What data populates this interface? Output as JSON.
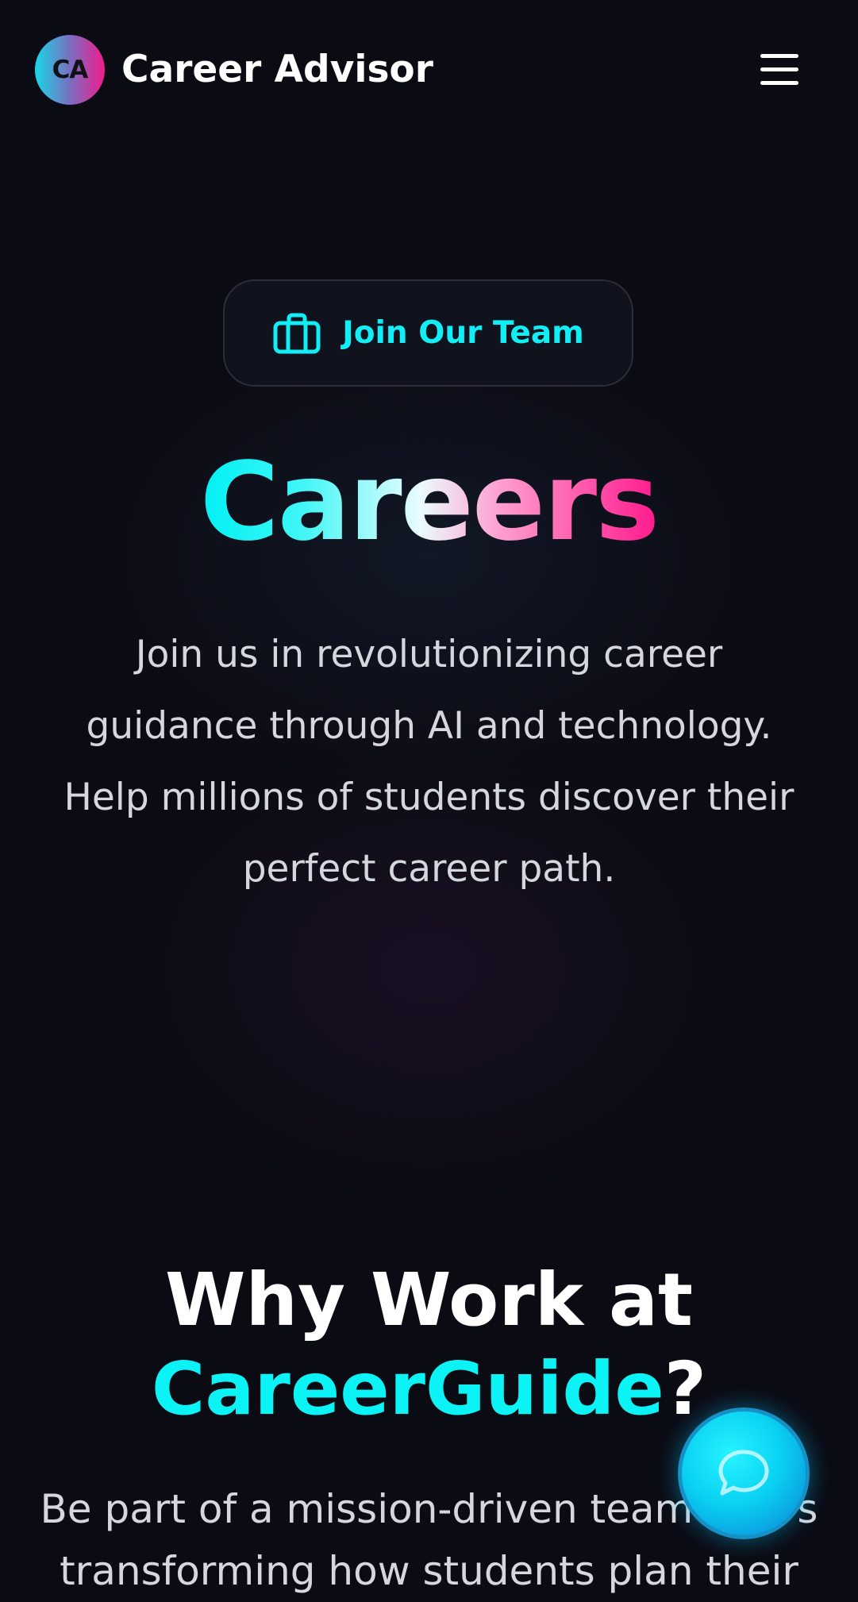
{
  "header": {
    "logo_initials": "CA",
    "brand_name": "Career Advisor",
    "menu_icon": "hamburger-menu-icon"
  },
  "hero": {
    "badge_icon": "briefcase-icon",
    "badge_label": "Join Our Team",
    "title": "Careers",
    "description": "Join us in revolutionizing career guidance through AI and technology. Help millions of students discover their perfect career path."
  },
  "why_section": {
    "title_prefix": "Why Work at",
    "title_accent": "CareerGuide",
    "title_suffix": "?",
    "description": "Be part of a mission-driven team that's transforming how students plan their"
  },
  "chat_widget": {
    "icon": "chat-bubble-icon"
  },
  "colors": {
    "background": "#0b0b14",
    "accent_cyan": "#0cf3f6",
    "accent_pink": "#ff1b8d",
    "text_muted": "#d4d7de"
  }
}
